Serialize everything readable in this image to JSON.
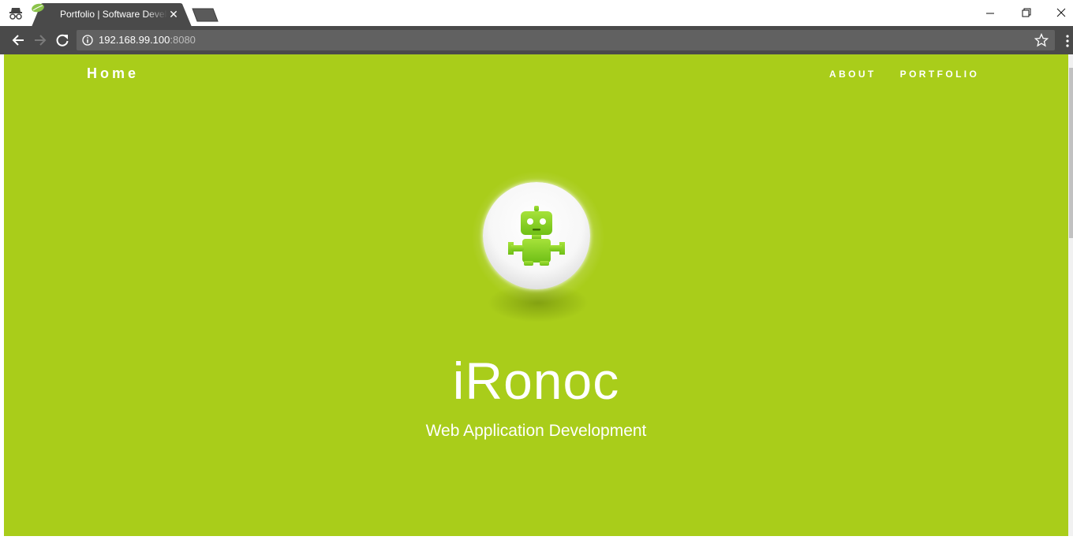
{
  "browser": {
    "tab_title": "Portfolio | Software Developer",
    "url_host": "192.168.99.100",
    "url_port": ":8080",
    "icons": [
      "incognito-icon",
      "spring-leaf-favicon",
      "close-icon",
      "minimize-icon",
      "restore-icon",
      "window-close-icon",
      "back-arrow-icon",
      "forward-arrow-icon",
      "reload-icon",
      "info-icon",
      "star-icon",
      "menu-icon"
    ]
  },
  "page": {
    "brand": "Home",
    "nav": [
      {
        "label": "ABOUT"
      },
      {
        "label": "PORTFOLIO"
      }
    ],
    "hero": {
      "title": "iRonoc",
      "subtitle": "Web Application Development",
      "avatar_icon": "robot-icon"
    }
  },
  "colors": {
    "page_background": "#a9cd1a",
    "robot_green": "#8fd11e",
    "toolbar": "#4a4a4a"
  }
}
